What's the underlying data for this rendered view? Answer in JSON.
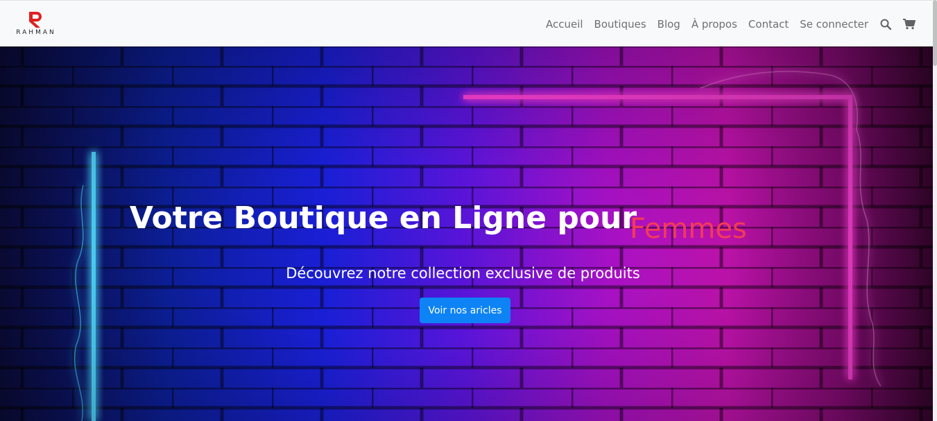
{
  "brand": {
    "logo_letter": "R",
    "logo_text": "RAHMAN",
    "logo_color": "#e02020"
  },
  "nav": {
    "items": [
      {
        "label": "Accueil"
      },
      {
        "label": "Boutiques"
      },
      {
        "label": "Blog"
      },
      {
        "label": "À propos"
      },
      {
        "label": "Contact"
      },
      {
        "label": "Se connecter"
      }
    ],
    "icons": [
      "search-icon",
      "cart-icon"
    ]
  },
  "hero": {
    "title": "Votre Boutique en Ligne pour",
    "accent_word": "Femmes",
    "subtitle": "Découvrez notre collection exclusive de produits",
    "button_label": "Voir nos aricles",
    "colors": {
      "accent": "#f23b57",
      "button": "#0d83f5",
      "neon_cyan": "#4fd8ff",
      "neon_pink": "#ff3fd8"
    }
  }
}
